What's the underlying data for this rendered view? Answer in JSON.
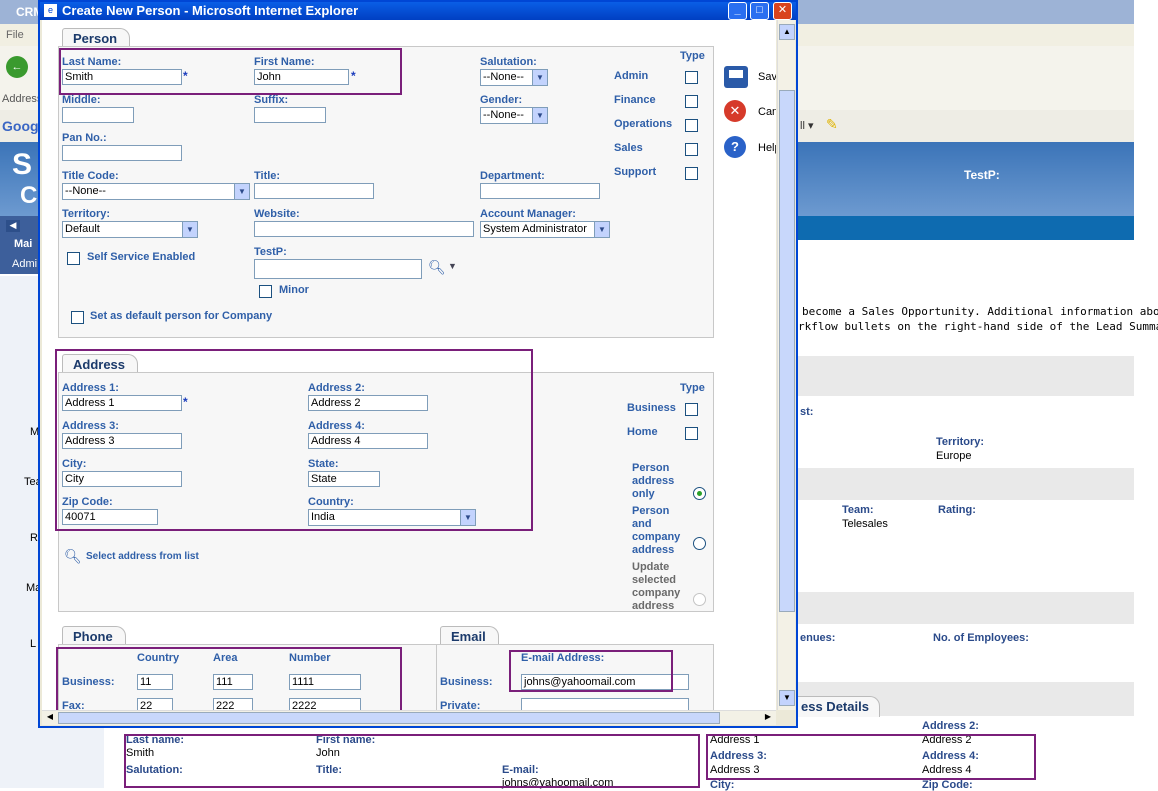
{
  "background": {
    "title": "CRM",
    "menu": "File",
    "address_label": "Address",
    "google": "Goog",
    "banner_text": "TestP:",
    "side_letters": [
      "S",
      "C"
    ],
    "nav_tabs": [
      "Mai",
      "Admi"
    ],
    "side_labels": [
      "M",
      "Tea",
      "R",
      "Ma",
      "L"
    ],
    "info_line1": "become a Sales Opportunity. Additional information about",
    "info_line2": "rkflow bullets on the right-hand side of the Lead Summary",
    "fields": {
      "st_label": "st:",
      "territory_label": "Territory:",
      "territory_value": "Europe",
      "team_label": "Team:",
      "team_value": "Telesales",
      "rating_label": "Rating:",
      "revenues_label": "enues:",
      "employees_label": "No. of Employees:",
      "details_tab": "ess Details"
    },
    "summary": {
      "last_name_label": "Last name:",
      "last_name_value": "Smith",
      "first_name_label": "First name:",
      "first_name_value": "John",
      "salutation_label": "Salutation:",
      "title_label": "Title:",
      "email_label": "E-mail:",
      "email_value": "johns@yahoomail.com",
      "address1_value": "Address 1",
      "address2_label": "Address 2:",
      "address2_value": "Address 2",
      "address3_label": "Address 3:",
      "address3_value": "Address 3",
      "address4_label": "Address 4:",
      "address4_value": "Address 4",
      "city_label": "City:",
      "zip_label": "Zip Code:"
    }
  },
  "dialog": {
    "title": "Create New Person - Microsoft Internet Explorer",
    "actions": {
      "save": "Save",
      "cancel": "Cancel",
      "help": "Help"
    }
  },
  "person": {
    "tab": "Person",
    "last_name_label": "Last Name:",
    "last_name": "Smith",
    "first_name_label": "First Name:",
    "first_name": "John",
    "salutation_label": "Salutation:",
    "salutation": "--None--",
    "middle_label": "Middle:",
    "suffix_label": "Suffix:",
    "gender_label": "Gender:",
    "gender": "--None--",
    "pan_label": "Pan No.:",
    "title_code_label": "Title Code:",
    "title_code": "--None--",
    "title_label": "Title:",
    "department_label": "Department:",
    "territory_label": "Territory:",
    "territory": "Default",
    "website_label": "Website:",
    "account_manager_label": "Account Manager:",
    "account_manager": "System Administrator",
    "self_service": "Self Service Enabled",
    "testp_label": "TestP:",
    "minor": "Minor",
    "default_person": "Set as default person for Company",
    "type_label": "Type",
    "types": [
      "Admin",
      "Finance",
      "Operations",
      "Sales",
      "Support"
    ]
  },
  "address": {
    "tab": "Address",
    "address1_label": "Address 1:",
    "address1": "Address 1",
    "address2_label": "Address 2:",
    "address2": "Address 2",
    "address3_label": "Address 3:",
    "address3": "Address 3",
    "address4_label": "Address 4:",
    "address4": "Address 4",
    "city_label": "City:",
    "city": "City",
    "state_label": "State:",
    "state": "State",
    "zip_label": "Zip Code:",
    "zip": "40071",
    "country_label": "Country:",
    "country": "India",
    "select_link": "Select address from list",
    "type_label": "Type",
    "types": [
      "Business",
      "Home"
    ],
    "scope_options": [
      [
        "Person",
        "address",
        "only"
      ],
      [
        "Person",
        "and",
        "company",
        "address"
      ],
      [
        "Update",
        "selected",
        "company",
        "address"
      ]
    ]
  },
  "phone": {
    "tab": "Phone",
    "col_country": "Country",
    "col_area": "Area",
    "col_number": "Number",
    "business_label": "Business:",
    "business_country": "11",
    "business_area": "111",
    "business_number": "1111",
    "fax_label": "Fax:",
    "fax_country": "22",
    "fax_area": "222",
    "fax_number": "2222"
  },
  "email": {
    "tab": "Email",
    "address_label": "E-mail Address:",
    "business_label": "Business:",
    "business": "johns@yahoomail.com",
    "private_label": "Private:"
  }
}
